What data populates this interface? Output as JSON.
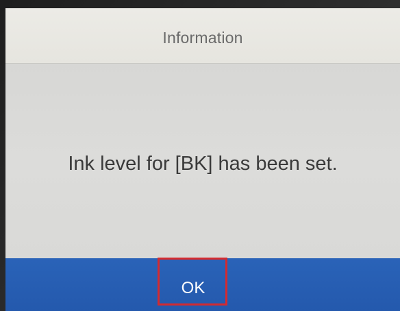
{
  "dialog": {
    "title": "Information",
    "message": "Ink level for [BK] has been set.",
    "ok_label": "OK"
  },
  "colors": {
    "title_bar": "#ecebe6",
    "message_background": "#dadad8",
    "button_bar": "#2a63b8",
    "highlight": "#d42a2f"
  }
}
